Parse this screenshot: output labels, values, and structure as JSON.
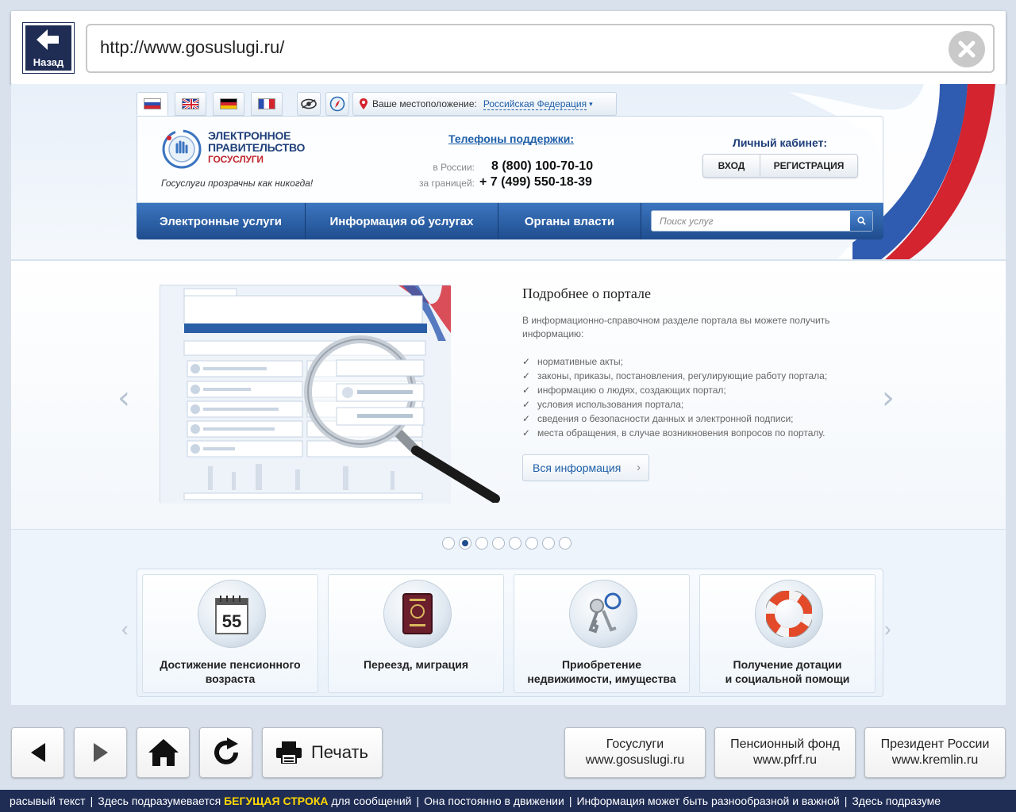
{
  "browser": {
    "back_label": "Назад",
    "url": "http://www.gosuslugi.ru/"
  },
  "site": {
    "flags": [
      "ru-flag-icon",
      "gb-flag-icon",
      "de-flag-icon",
      "fr-flag-icon"
    ],
    "location_label": "Ваше местоположение:",
    "location_value": "Российская Федерация",
    "logo_line1": "ЭЛЕКТРОННОЕ",
    "logo_line2": "ПРАВИТЕЛЬСТВО",
    "logo_line3": "ГОСУСЛУГИ",
    "slogan": "Госуслуги прозрачны как никогда!",
    "phones_title": "Телефоны поддержки:",
    "phone_ru_label": "в России:",
    "phone_ru": "8 (800) 100-70-10",
    "phone_abroad_label": "за границей:",
    "phone_abroad": "+ 7 (499) 550-18-39",
    "cabinet_title": "Личный кабинет:",
    "login_label": "ВХОД",
    "register_label": "РЕГИСТРАЦИЯ",
    "nav": [
      "Электронные услуги",
      "Информация об услугах",
      "Органы власти"
    ],
    "search_placeholder": "Поиск услуг"
  },
  "slide": {
    "title": "Подробнее о портале",
    "description": "В информационно-справочном разделе портала вы можете получить информацию:",
    "items": [
      "нормативные акты;",
      "законы, приказы, постановления, регулирующие работу портала;",
      "информацию о людях, создающих портал;",
      "условия использования портала;",
      "сведения о безопасности данных и электронной подписи;",
      "места обращения, в случае возникновения вопросов по порталу."
    ],
    "more_label": "Вся информация",
    "dot_count": 8,
    "active_dot": 2
  },
  "cards": [
    {
      "label": "Достижение пенсионного\nвозраста",
      "icon": "calendar-icon",
      "icon_text": "55"
    },
    {
      "label": "Переезд, миграция",
      "icon": "passport-icon"
    },
    {
      "label": "Приобретение\nнедвижимости, имущества",
      "icon": "keys-icon"
    },
    {
      "label": "Получение дотации\nи социальной помощи",
      "icon": "lifebuoy-icon"
    }
  ],
  "toolbar": {
    "print_label": "Печать",
    "links": [
      {
        "name": "Госуслуги",
        "url": "www.gosuslugi.ru"
      },
      {
        "name": "Пенсионный фонд",
        "url": "www.pfrf.ru"
      },
      {
        "name": "Президент России",
        "url": "www.kremlin.ru"
      }
    ]
  },
  "ticker": {
    "seg1": "расывый текст",
    "seg2_a": "Здесь подразумевается ",
    "seg2_hl": "БЕГУЩАЯ СТРОКА",
    "seg2_b": " для сообщений",
    "seg3": "Она постоянно в движении",
    "seg4": "Информация может быть разнообразной и важной",
    "seg5": "Здесь подразуме"
  },
  "colors": {
    "navy": "#1f2d55",
    "nav_blue": "#2a5ea6",
    "accent_yellow": "#ffd800"
  }
}
